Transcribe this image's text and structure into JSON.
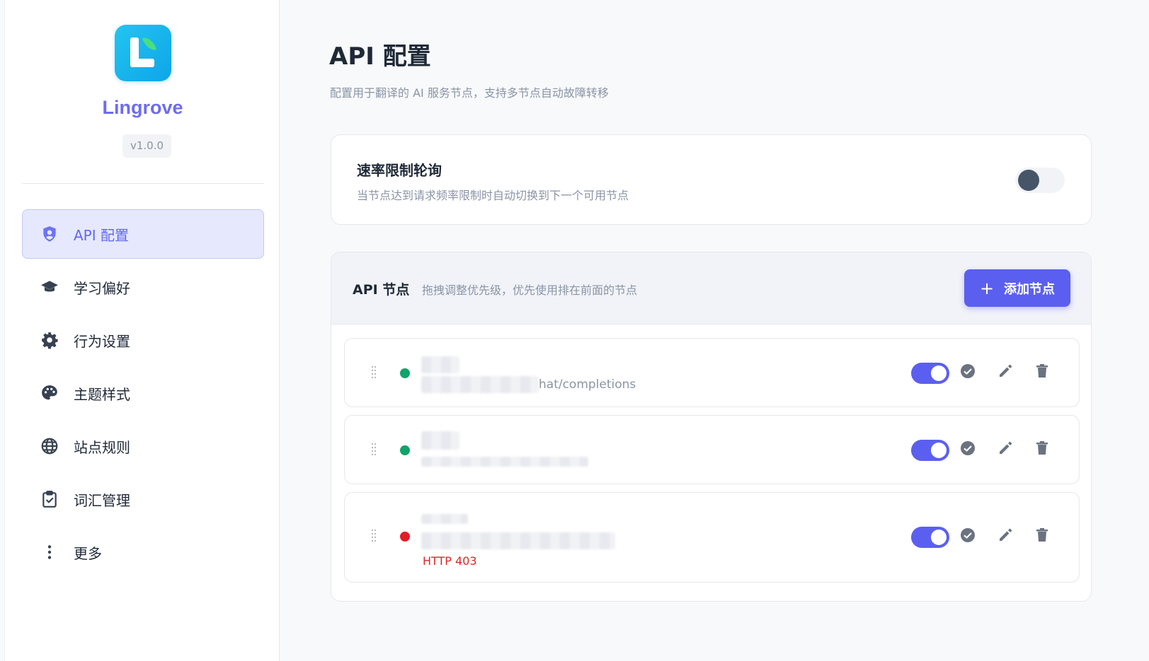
{
  "app": {
    "name": "Lingrove",
    "version": "v1.0.0"
  },
  "sidebar": {
    "items": [
      {
        "label": "API 配置",
        "icon": "shield-user-icon",
        "active": true
      },
      {
        "label": "学习偏好",
        "icon": "graduation-cap-icon"
      },
      {
        "label": "行为设置",
        "icon": "gear-icon"
      },
      {
        "label": "主题样式",
        "icon": "palette-icon"
      },
      {
        "label": "站点规则",
        "icon": "globe-icon"
      },
      {
        "label": "词汇管理",
        "icon": "clipboard-check-icon"
      },
      {
        "label": "更多",
        "icon": "more-vertical-icon"
      }
    ]
  },
  "page": {
    "title": "API 配置",
    "description": "配置用于翻译的 AI 服务节点，支持多节点自动故障转移"
  },
  "rate_limit": {
    "title": "速率限制轮询",
    "description": "当节点达到请求频率限制时自动切换到下一个可用节点",
    "enabled": false
  },
  "nodes": {
    "title": "API 节点",
    "hint": "拖拽调整优先级，优先使用排在前面的节点",
    "add_label": "添加节点",
    "list": [
      {
        "status": "ok",
        "url_suffix": "hat/completions",
        "enabled": true,
        "error": ""
      },
      {
        "status": "ok",
        "url_suffix": "",
        "enabled": true,
        "error": ""
      },
      {
        "status": "error",
        "url_suffix": "",
        "enabled": true,
        "error": "HTTP 403"
      }
    ]
  },
  "colors": {
    "accent": "#5b5ff0",
    "ok": "#10a36b",
    "error": "#e11d2b",
    "brand": "#6d6cf0"
  }
}
